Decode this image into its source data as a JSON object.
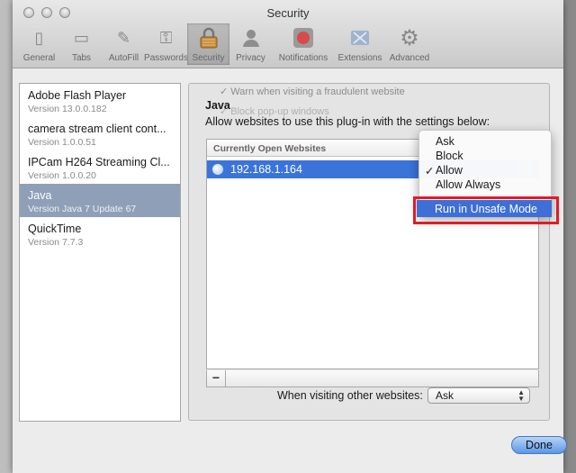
{
  "window": {
    "title": "Security"
  },
  "toolbar": {
    "items": [
      {
        "label": "General",
        "icon": "switch-icon"
      },
      {
        "label": "Tabs",
        "icon": "tabs-icon"
      },
      {
        "label": "AutoFill",
        "icon": "pencil-icon"
      },
      {
        "label": "Passwords",
        "icon": "key-icon"
      },
      {
        "label": "Security",
        "icon": "lock-icon",
        "selected": true
      },
      {
        "label": "Privacy",
        "icon": "person-icon"
      },
      {
        "label": "Notifications",
        "icon": "record-icon"
      },
      {
        "label": "Extensions",
        "icon": "puzzle-icon"
      },
      {
        "label": "Advanced",
        "icon": "gear-icon"
      }
    ]
  },
  "sidebar": {
    "plugins": [
      {
        "name": "Adobe Flash Player",
        "version": "Version 13.0.0.182"
      },
      {
        "name": "camera stream client cont...",
        "version": "Version 1.0.0.51"
      },
      {
        "name": "IPCam H264 Streaming Cl...",
        "version": "Version 1.0.0.20"
      },
      {
        "name": "Java",
        "version": "Version Java 7 Update 67",
        "selected": true
      },
      {
        "name": "QuickTime",
        "version": "Version 7.7.3"
      }
    ]
  },
  "background_text": {
    "warn": "✓ Warn when visiting a fraudulent website",
    "block": "✓ Block pop-up windows"
  },
  "panel": {
    "plugin_title": "Java",
    "instructions": "Allow websites to use this plug-in with the settings below:",
    "column_header": "Currently Open Websites",
    "sites": [
      "192.168.1.164"
    ],
    "remove_label": "−",
    "other_label": "When visiting other websites:",
    "other_value": "Ask"
  },
  "popup": {
    "items": [
      "Ask",
      "Block",
      "Allow",
      "Allow Always"
    ],
    "checked": "Allow",
    "check_mark": "✓",
    "highlighted_item": "Run in Unsafe Mode"
  },
  "footer": {
    "done_label": "Done"
  },
  "colors": {
    "selection_blue": "#3b74d9",
    "highlight_red": "#e11c27"
  }
}
